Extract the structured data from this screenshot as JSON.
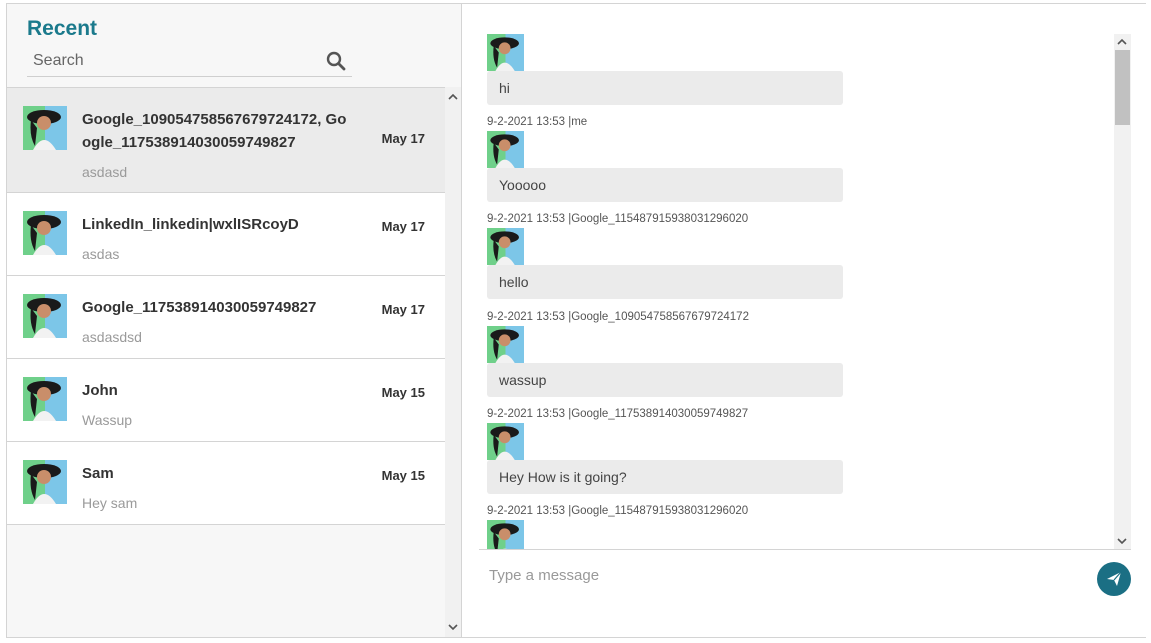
{
  "sidebar": {
    "title": "Recent",
    "search": {
      "placeholder": "Search",
      "value": ""
    },
    "conversations": [
      {
        "name": "Google_109054758567679724172, Google_117538914030059749827",
        "date": "May 17",
        "preview": "asdasd",
        "selected": true
      },
      {
        "name": "LinkedIn_linkedin|wxlISRcoyD",
        "date": "May 17",
        "preview": "asdas"
      },
      {
        "name": "Google_117538914030059749827",
        "date": "May 17",
        "preview": "asdasdsd"
      },
      {
        "name": "John",
        "date": "May 15",
        "preview": "Wassup"
      },
      {
        "name": "Sam",
        "date": "May 15",
        "preview": "Hey sam"
      }
    ]
  },
  "chat": {
    "messages": [
      {
        "text": "hi",
        "meta": "9-2-2021 13:53 |me"
      },
      {
        "text": "Yooooo",
        "meta": "9-2-2021 13:53 |Google_115487915938031296020"
      },
      {
        "text": "hello",
        "meta": "9-2-2021 13:53 |Google_109054758567679724172"
      },
      {
        "text": "wassup",
        "meta": "9-2-2021 13:53 |Google_117538914030059749827"
      },
      {
        "text": "Hey How is it going?",
        "meta": "9-2-2021 13:53 |Google_115487915938031296020"
      }
    ],
    "composer": {
      "placeholder": "Type a message",
      "value": ""
    }
  },
  "colors": {
    "accent": "#1b7a8c",
    "send_button": "#1b6f84",
    "bubble": "#ebebeb"
  }
}
